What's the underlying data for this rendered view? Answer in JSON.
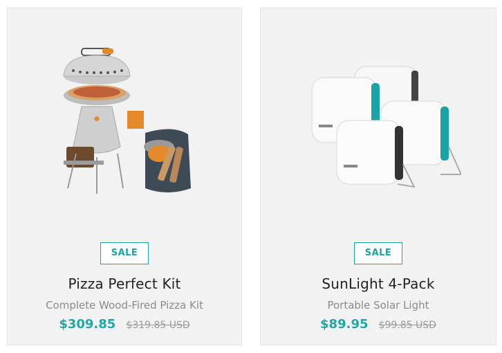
{
  "products": [
    {
      "badge": "SALE",
      "title": "Pizza Perfect Kit",
      "subtitle": "Complete Wood-Fired Pizza Kit",
      "sale_price": "$309.85",
      "original_price": "$319.85 USD"
    },
    {
      "badge": "SALE",
      "title": "SunLight 4-Pack",
      "subtitle": "Portable Solar Light",
      "sale_price": "$89.95",
      "original_price": "$99.85 USD"
    }
  ],
  "colors": {
    "accent": "#1aa3a3",
    "card_background": "#f2f2f2",
    "title_text": "#222222",
    "subtitle_text": "#8a8a8a",
    "strike_price": "#9a9a9a"
  },
  "icons": {
    "card1_image": "pizza-stove-kit-image",
    "card2_image": "solar-lights-image"
  }
}
